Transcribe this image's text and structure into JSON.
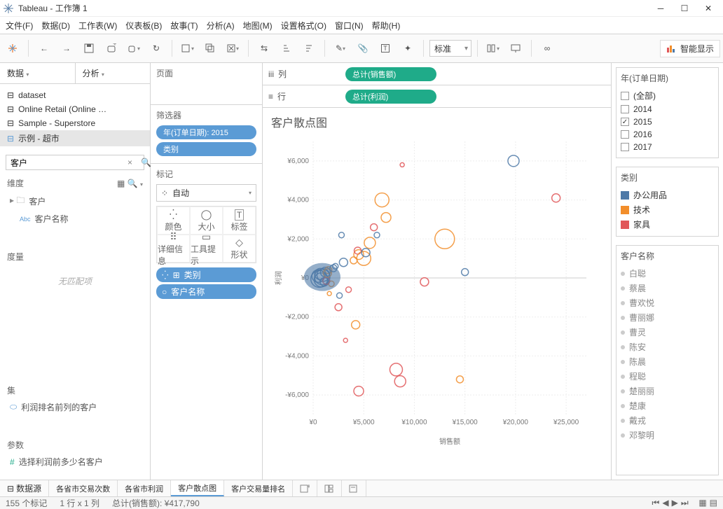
{
  "window": {
    "title": "Tableau - 工作簿 1"
  },
  "menu": {
    "file": "文件(F)",
    "data": "数据(D)",
    "worksheet": "工作表(W)",
    "dashboard": "仪表板(B)",
    "story": "故事(T)",
    "analysis": "分析(A)",
    "map": "地图(M)",
    "format": "设置格式(O)",
    "window": "窗口(N)",
    "help": "帮助(H)"
  },
  "toolbar": {
    "fit": "标准",
    "smart": "智能显示"
  },
  "left": {
    "tab_data": "数据",
    "tab_analysis": "分析",
    "ds": [
      "dataset",
      "Online Retail (Online …",
      "Sample - Superstore",
      "示例 - 超市"
    ],
    "search": "客户",
    "dim_h": "维度",
    "dim_items": [
      {
        "icon": "folder",
        "label": "客户"
      },
      {
        "icon": "abc",
        "label": "客户名称"
      }
    ],
    "meas_h": "度量",
    "nomatch": "无匹配项",
    "set_h": "集",
    "set_items": [
      "利润排名前列的客户"
    ],
    "param_h": "参数",
    "param_items": [
      "选择利润前多少名客户"
    ]
  },
  "mid": {
    "page_h": "页面",
    "filter_h": "筛选器",
    "filters": [
      "年(订单日期): 2015",
      "类别"
    ],
    "marks_h": "标记",
    "marks_type": "自动",
    "cells": [
      "颜色",
      "大小",
      "标签",
      "详细信息",
      "工具提示",
      "形状"
    ],
    "markpills": [
      {
        "icon": "⊞",
        "label": "类别"
      },
      {
        "icon": "○",
        "label": "客户名称"
      }
    ]
  },
  "shelves": {
    "col_h": "列",
    "col_pill": "总计(销售额)",
    "row_h": "行",
    "row_pill": "总计(利润)"
  },
  "chart_data": {
    "type": "scatter",
    "title": "客户散点图",
    "xlabel": "销售额",
    "ylabel": "利润",
    "xlim": [
      0,
      27000
    ],
    "ylim": [
      -7000,
      7000
    ],
    "xticks": [
      0,
      5000,
      10000,
      15000,
      20000,
      25000
    ],
    "xtick_labels": [
      "¥0",
      "¥5,000",
      "¥10,000",
      "¥15,000",
      "¥20,000",
      "¥25,000"
    ],
    "yticks": [
      -6000,
      -4000,
      -2000,
      0,
      2000,
      4000,
      6000
    ],
    "ytick_labels": [
      "-¥6,000",
      "-¥4,000",
      "-¥2,000",
      "¥0",
      "¥2,000",
      "¥4,000",
      "¥6,000"
    ],
    "series": [
      {
        "name": "办公用品",
        "color": "#4e79a7"
      },
      {
        "name": "技术",
        "color": "#f28e2b"
      },
      {
        "name": "家具",
        "color": "#e15759"
      }
    ],
    "points": [
      {
        "x": 500,
        "y": 100,
        "r": 18,
        "s": 0
      },
      {
        "x": 800,
        "y": -100,
        "r": 20,
        "s": 0
      },
      {
        "x": 1200,
        "y": 300,
        "r": 14,
        "s": 0
      },
      {
        "x": 900,
        "y": 50,
        "r": 22,
        "s": 0
      },
      {
        "x": 1100,
        "y": -200,
        "r": 12,
        "s": 0
      },
      {
        "x": 700,
        "y": 200,
        "r": 16,
        "s": 0
      },
      {
        "x": 1500,
        "y": 400,
        "r": 10,
        "s": 1
      },
      {
        "x": 1800,
        "y": -300,
        "r": 8,
        "s": 1
      },
      {
        "x": 600,
        "y": -50,
        "r": 24,
        "s": 0
      },
      {
        "x": 1000,
        "y": 150,
        "r": 18,
        "s": 0
      },
      {
        "x": 1300,
        "y": -150,
        "r": 10,
        "s": 2
      },
      {
        "x": 1400,
        "y": 250,
        "r": 12,
        "s": 1
      },
      {
        "x": 2000,
        "y": 500,
        "r": 10,
        "s": 0
      },
      {
        "x": 4500,
        "y": 1200,
        "r": 14,
        "s": 1
      },
      {
        "x": 4400,
        "y": 1400,
        "r": 10,
        "s": 2
      },
      {
        "x": 3000,
        "y": 800,
        "r": 12,
        "s": 0
      },
      {
        "x": 3500,
        "y": -600,
        "r": 8,
        "s": 2
      },
      {
        "x": 5000,
        "y": 1000,
        "r": 20,
        "s": 1
      },
      {
        "x": 6800,
        "y": 4000,
        "r": 20,
        "s": 1
      },
      {
        "x": 7200,
        "y": 3100,
        "r": 14,
        "s": 1
      },
      {
        "x": 5200,
        "y": 1300,
        "r": 12,
        "s": 0
      },
      {
        "x": 5600,
        "y": 1800,
        "r": 16,
        "s": 1
      },
      {
        "x": 8200,
        "y": -4700,
        "r": 18,
        "s": 2
      },
      {
        "x": 8600,
        "y": -5300,
        "r": 16,
        "s": 2
      },
      {
        "x": 13000,
        "y": 2000,
        "r": 28,
        "s": 1
      },
      {
        "x": 11000,
        "y": -200,
        "r": 12,
        "s": 2
      },
      {
        "x": 15000,
        "y": 300,
        "r": 10,
        "s": 0
      },
      {
        "x": 14500,
        "y": -5200,
        "r": 10,
        "s": 1
      },
      {
        "x": 19800,
        "y": 6000,
        "r": 16,
        "s": 0
      },
      {
        "x": 24000,
        "y": 4100,
        "r": 12,
        "s": 2
      },
      {
        "x": 2500,
        "y": -1500,
        "r": 10,
        "s": 2
      },
      {
        "x": 3200,
        "y": -3200,
        "r": 6,
        "s": 2
      },
      {
        "x": 4200,
        "y": -2400,
        "r": 12,
        "s": 1
      },
      {
        "x": 2800,
        "y": 2200,
        "r": 8,
        "s": 0
      },
      {
        "x": 4000,
        "y": 900,
        "r": 10,
        "s": 1
      },
      {
        "x": 4500,
        "y": -5800,
        "r": 14,
        "s": 2
      },
      {
        "x": 8800,
        "y": 5800,
        "r": 6,
        "s": 2
      },
      {
        "x": 1600,
        "y": -800,
        "r": 6,
        "s": 1
      },
      {
        "x": 2200,
        "y": 600,
        "r": 8,
        "s": 0
      },
      {
        "x": 2600,
        "y": -900,
        "r": 8,
        "s": 0
      },
      {
        "x": 6000,
        "y": 2600,
        "r": 10,
        "s": 2
      },
      {
        "x": 6300,
        "y": 2200,
        "r": 8,
        "s": 0
      }
    ]
  },
  "right": {
    "year_h": "年(订单日期)",
    "years": [
      {
        "label": "(全部)",
        "chk": false
      },
      {
        "label": "2014",
        "chk": false
      },
      {
        "label": "2015",
        "chk": true
      },
      {
        "label": "2016",
        "chk": false
      },
      {
        "label": "2017",
        "chk": false
      }
    ],
    "cat_h": "类别",
    "cust_h": "客户名称",
    "customers": [
      "白聪",
      "蔡晨",
      "曹欢悦",
      "曹丽娜",
      "曹灵",
      "陈安",
      "陈晨",
      "程聪",
      "楚丽丽",
      "楚康",
      "戴戎",
      "邓黎明"
    ]
  },
  "sheets": {
    "ds": "数据源",
    "tabs": [
      "各省市交易次数",
      "各省市利润",
      "客户散点图",
      "客户交易量排名"
    ],
    "active": 2
  },
  "status": {
    "marks": "155 个标记",
    "rows": "1 行 x 1 列",
    "sum": "总计(销售额): ¥417,790"
  }
}
